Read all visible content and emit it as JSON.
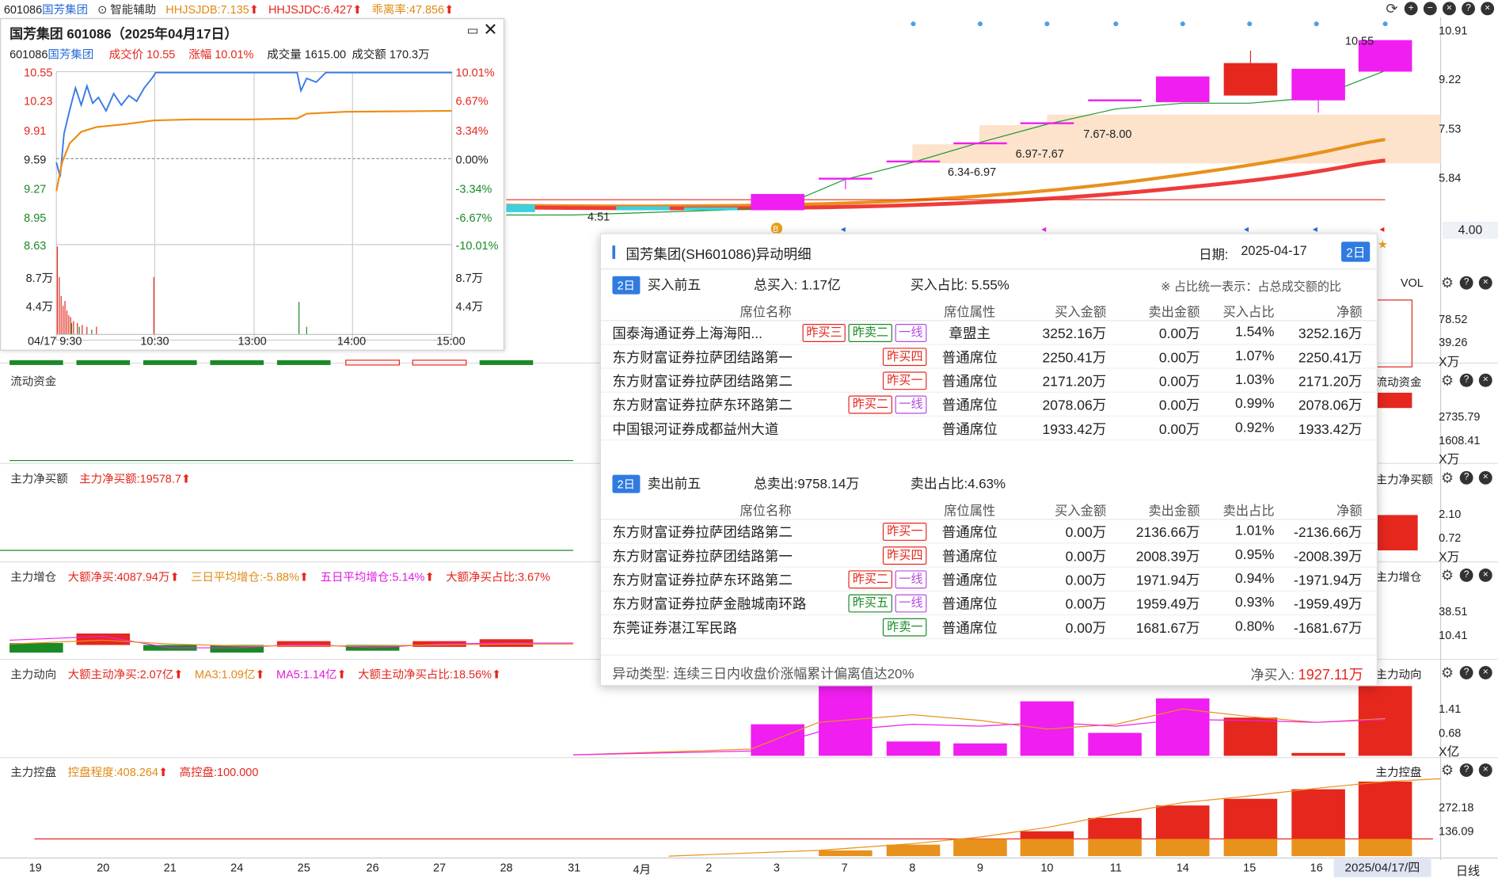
{
  "topbar": {
    "code_name": "601086",
    "name": "国芳集团",
    "assist_label": "智能辅助",
    "ind1": "HHJSJDB:7.135",
    "ind2": "HHJSJDC:6.427",
    "ind3": "乖离率:47.856"
  },
  "main_price_axis": [
    "10.91",
    "9.22",
    "7.53",
    "5.84",
    "4.00"
  ],
  "candle_labels": {
    "high": "10.55",
    "low": "4.51",
    "zone1": "6.34-6.97",
    "zone2": "6.97-7.67",
    "zone3": "7.67-8.00"
  },
  "mini_chart": {
    "title": "国芳集团 601086（2025年04月17日）",
    "code": "601086",
    "name": "国芳集团",
    "price_label": "成交价",
    "price": "10.55",
    "change_label": "涨幅",
    "change": "10.01%",
    "volume_label": "成交量",
    "volume": "1615.00",
    "amount_label": "成交额",
    "amount": "170.3",
    "amount_unit": "万",
    "left_axis": [
      "10.55",
      "10.23",
      "9.91",
      "9.59",
      "9.27",
      "8.95",
      "8.63"
    ],
    "right_axis": [
      "10.01%",
      "6.67%",
      "3.34%",
      "0.00%",
      "-3.34%",
      "-6.67%",
      "-10.01%"
    ],
    "vol_axis": [
      "8.7万",
      "4.4万"
    ],
    "time_axis": [
      "04/17 9:30",
      "10:30",
      "13:00",
      "14:00",
      "15:00"
    ]
  },
  "panels": {
    "vol": {
      "label": "VOL",
      "axis": [
        "78.52",
        "39.26"
      ],
      "unit": "X万"
    },
    "liquid": {
      "title": "流动资金",
      "right_label": "流动资金",
      "axis": [
        "2735.79",
        "1608.41"
      ],
      "unit": "X万"
    },
    "netbuy": {
      "title": "主力净买额",
      "v1": "主力净买额:19578.7",
      "right_label": "主力净买额",
      "axis": [
        "2.10",
        "0.72"
      ],
      "unit": "X万"
    },
    "increase": {
      "title": "主力增仓",
      "v1": "大额净买:4087.94万",
      "v2": "三日平均增仓:-5.88%",
      "v3": "五日平均增仓:5.14%",
      "v4": "大额净买占比:3.67%",
      "right_label": "主力增仓",
      "axis": [
        "38.51",
        "10.41"
      ]
    },
    "trend": {
      "title": "主力动向",
      "v1": "大额主动净买:2.07亿",
      "v2": "MA3:1.09亿",
      "v3": "MA5:1.14亿",
      "v4": "大额主动净买占比:18.56%",
      "right_label": "主力动向",
      "axis": [
        "1.41",
        "0.68"
      ],
      "unit": "X亿"
    },
    "control": {
      "title": "主力控盘",
      "v1": "控盘程度:408.264",
      "v2": "高控盘:100.000",
      "right_label": "主力控盘",
      "axis": [
        "272.18",
        "136.09"
      ]
    }
  },
  "x_axis": [
    "19",
    "20",
    "21",
    "24",
    "25",
    "26",
    "27",
    "28",
    "31",
    "4月",
    "2",
    "3",
    "7",
    "8",
    "9",
    "10",
    "11",
    "14",
    "15",
    "16"
  ],
  "x_date": "2025/04/17/四",
  "period": "日线",
  "popup": {
    "title": "国芳集团(SH601086)异动明细",
    "date_label": "日期:",
    "date": "2025-04-17",
    "period_badge": "2日",
    "buy": {
      "badge": "2日",
      "label": "买入前五",
      "total": "总买入: 1.17亿",
      "ratio": "买入占比: 5.55%",
      "note": "※ 占比统一表示：占总成交额的比",
      "headers": [
        "席位名称",
        "席位属性",
        "买入金额",
        "卖出金额",
        "买入占比",
        "净额"
      ],
      "rows": [
        {
          "name": "国泰海通证券上海海阳...",
          "tags": [
            {
              "t": "昨买三",
              "c": "r"
            },
            {
              "t": "昨卖二",
              "c": "g"
            },
            {
              "t": "一线",
              "c": "p"
            }
          ],
          "attr": "章盟主",
          "buy": "3252.16万",
          "sell": "0.00万",
          "ratio": "1.54%",
          "net": "3252.16万"
        },
        {
          "name": "东方财富证券拉萨团结路第一",
          "tags": [
            {
              "t": "昨买四",
              "c": "r"
            }
          ],
          "attr": "普通席位",
          "buy": "2250.41万",
          "sell": "0.00万",
          "ratio": "1.07%",
          "net": "2250.41万"
        },
        {
          "name": "东方财富证券拉萨团结路第二",
          "tags": [
            {
              "t": "昨买一",
              "c": "r"
            }
          ],
          "attr": "普通席位",
          "buy": "2171.20万",
          "sell": "0.00万",
          "ratio": "1.03%",
          "net": "2171.20万"
        },
        {
          "name": "东方财富证券拉萨东环路第二",
          "tags": [
            {
              "t": "昨买二",
              "c": "r"
            },
            {
              "t": "一线",
              "c": "p"
            }
          ],
          "attr": "普通席位",
          "buy": "2078.06万",
          "sell": "0.00万",
          "ratio": "0.99%",
          "net": "2078.06万"
        },
        {
          "name": "中国银河证券成都益州大道",
          "tags": [],
          "attr": "普通席位",
          "buy": "1933.42万",
          "sell": "0.00万",
          "ratio": "0.92%",
          "net": "1933.42万"
        }
      ]
    },
    "sell": {
      "badge": "2日",
      "label": "卖出前五",
      "total": "总卖出:9758.14万",
      "ratio": "卖出占比:4.63%",
      "headers": [
        "席位名称",
        "席位属性",
        "买入金额",
        "卖出金额",
        "卖出占比",
        "净额"
      ],
      "rows": [
        {
          "name": "东方财富证券拉萨团结路第二",
          "tags": [
            {
              "t": "昨买一",
              "c": "r"
            }
          ],
          "attr": "普通席位",
          "buy": "0.00万",
          "sell": "2136.66万",
          "ratio": "1.01%",
          "net": "-2136.66万"
        },
        {
          "name": "东方财富证券拉萨团结路第一",
          "tags": [
            {
              "t": "昨买四",
              "c": "r"
            }
          ],
          "attr": "普通席位",
          "buy": "0.00万",
          "sell": "2008.39万",
          "ratio": "0.95%",
          "net": "-2008.39万"
        },
        {
          "name": "东方财富证券拉萨东环路第二",
          "tags": [
            {
              "t": "昨买二",
              "c": "r"
            },
            {
              "t": "一线",
              "c": "p"
            }
          ],
          "attr": "普通席位",
          "buy": "0.00万",
          "sell": "1971.94万",
          "ratio": "0.94%",
          "net": "-1971.94万"
        },
        {
          "name": "东方财富证券拉萨金融城南环路",
          "tags": [
            {
              "t": "昨买五",
              "c": "g"
            },
            {
              "t": "一线",
              "c": "p"
            }
          ],
          "attr": "普通席位",
          "buy": "0.00万",
          "sell": "1959.49万",
          "ratio": "0.93%",
          "net": "-1959.49万"
        },
        {
          "name": "东莞证券湛江军民路",
          "tags": [
            {
              "t": "昨卖一",
              "c": "g"
            }
          ],
          "attr": "普通席位",
          "buy": "0.00万",
          "sell": "1681.67万",
          "ratio": "0.80%",
          "net": "-1681.67万"
        }
      ]
    },
    "footer_type": "异动类型: 连续三日内收盘价涨幅累计偏离值达20%",
    "net_label": "净买入:",
    "net_value": "1927.11万"
  },
  "colors": {
    "up": "#e5271e",
    "down": "#1a8a26",
    "magenta": "#f01ef0",
    "orange": "#e8911c",
    "zone": "#fbe0c8",
    "accent": "#2f7be0"
  }
}
